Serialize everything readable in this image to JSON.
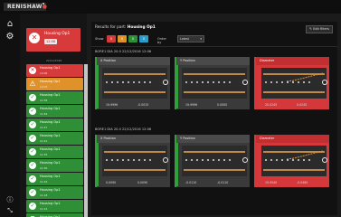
{
  "brand": "RENISHAW",
  "nav": {
    "home_icon": "home-icon",
    "settings_icon": "gear-icon",
    "info_icon": "info-icon",
    "expand_icon": "expand-icon"
  },
  "sidebar": {
    "selected": {
      "title": "Housing Op1",
      "sub": "12:06"
    },
    "date": "22/12/2016",
    "items": [
      {
        "name": "Housing Op1",
        "time": "12:06",
        "status": "red"
      },
      {
        "name": "Housing Op1",
        "time": "12:03",
        "status": "orange"
      },
      {
        "name": "Housing Op1",
        "time": "11:58",
        "status": "green"
      },
      {
        "name": "Housing Op1",
        "time": "11:52",
        "status": "green"
      },
      {
        "name": "Housing Op1",
        "time": "11:47",
        "status": "green"
      },
      {
        "name": "Housing Op1",
        "time": "11:41",
        "status": "green"
      },
      {
        "name": "Housing Op1",
        "time": "11:35",
        "status": "green"
      },
      {
        "name": "Housing Op1",
        "time": "11:30",
        "status": "green"
      },
      {
        "name": "Housing Op1",
        "time": "11:24",
        "status": "green"
      },
      {
        "name": "Housing Op1",
        "time": "11:18",
        "status": "green"
      },
      {
        "name": "Housing Op1",
        "time": "11:12",
        "status": "green"
      },
      {
        "name": "Housing Op1",
        "time": "11:06",
        "status": "green"
      }
    ]
  },
  "main": {
    "results_prefix": "Results for part:",
    "part_name": "Housing Op1",
    "edit_label": "Edit filters",
    "show_label": "Show",
    "chips": [
      {
        "label": "0",
        "color": "#d63a3a"
      },
      {
        "label": "0",
        "color": "#e0922a"
      },
      {
        "label": "0",
        "color": "#2f8f36"
      },
      {
        "label": "0",
        "color": "#2b9dc9"
      }
    ],
    "order_label": "Order by",
    "order_value": "Latest",
    "groups": [
      {
        "label": "BORE1 DIA 20.0   22/12/2016   12:06",
        "cards": [
          {
            "title": "X Position",
            "foot_left": "19.9996",
            "foot_right": "-0.0015",
            "status": "pass"
          },
          {
            "title": "Y Position",
            "foot_left": "19.9996",
            "foot_right": "0.0000",
            "status": "pass"
          },
          {
            "title": "Diameter",
            "foot_left": "20.0245",
            "foot_right": "0.0245",
            "status": "fail"
          }
        ]
      },
      {
        "label": "BORE1 DIA 20.0   22/12/2016   12:06",
        "cards": [
          {
            "title": "X Position",
            "foot_left": "0.0090",
            "foot_right": "0.0090",
            "status": "pass"
          },
          {
            "title": "Y Position",
            "foot_left": "-0.0110",
            "foot_right": "-0.0110",
            "status": "pass"
          },
          {
            "title": "Diameter",
            "foot_left": "19.9540",
            "foot_right": "-0.0460",
            "status": "fail"
          }
        ]
      }
    ]
  },
  "colors": {
    "red": "#d63a3a",
    "orange": "#e0922a",
    "green": "#2f8f36",
    "blue": "#2b9dc9"
  }
}
